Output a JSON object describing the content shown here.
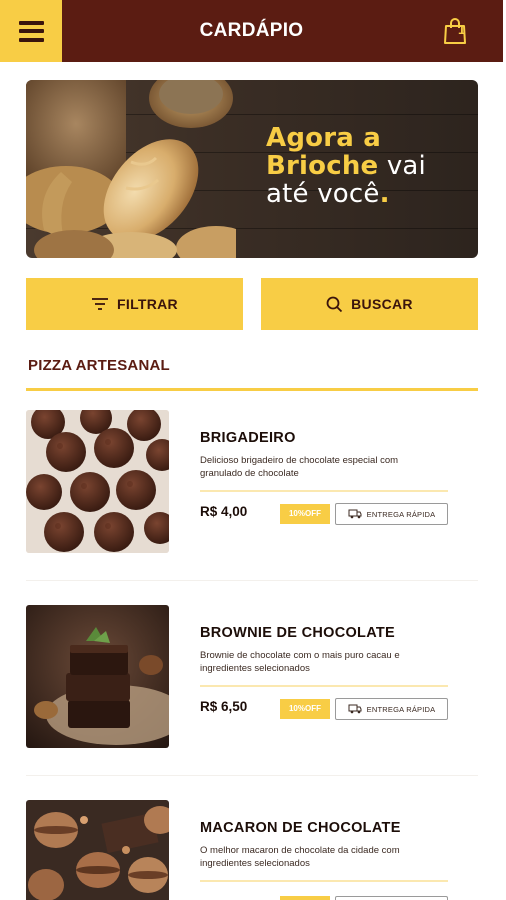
{
  "header": {
    "title": "CARDÁPIO",
    "cart_count": "1",
    "menu_icon": "hamburger-menu-icon",
    "cart_icon": "shopping-bag-icon"
  },
  "banner": {
    "line1": "Agora a",
    "line2_highlight": "Brioche",
    "line2_rest": " vai",
    "line3": "até você",
    "dot": "."
  },
  "actions": {
    "filter_label": "FILTRAR",
    "search_label": "BUSCAR"
  },
  "section": {
    "title": "PIZZA ARTESANAL"
  },
  "products": [
    {
      "name": "BRIGADEIRO",
      "description": "Delicioso brigadeiro de chocolate especial com granulado de chocolate",
      "price": "R$ 4,00",
      "discount": "10%OFF",
      "delivery": "ENTREGA RÁPIDA"
    },
    {
      "name": "BROWNIE DE CHOCOLATE",
      "description": "Brownie de chocolate com o mais puro cacau e ingredientes selecionados",
      "price": "R$ 6,50",
      "discount": "10%OFF",
      "delivery": "ENTREGA RÁPIDA"
    },
    {
      "name": "MACARON DE CHOCOLATE",
      "description": "O melhor macaron de chocolate da cidade com ingredientes selecionados",
      "price": "",
      "discount": "",
      "delivery": ""
    }
  ],
  "colors": {
    "brand_dark": "#5b1c12",
    "accent_yellow": "#f8cd45"
  }
}
